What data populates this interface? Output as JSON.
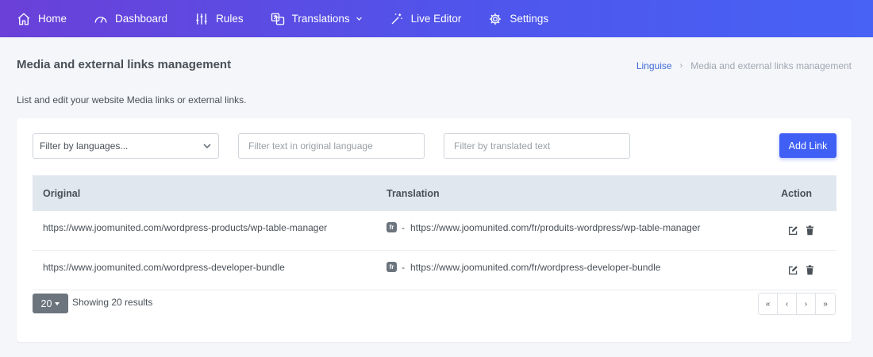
{
  "nav": {
    "items": [
      {
        "label": "Home",
        "icon": "home-icon"
      },
      {
        "label": "Dashboard",
        "icon": "gauge-icon"
      },
      {
        "label": "Rules",
        "icon": "sliders-icon"
      },
      {
        "label": "Translations",
        "icon": "translate-icon"
      },
      {
        "label": "Live Editor",
        "icon": "magic-wand-icon"
      },
      {
        "label": "Settings",
        "icon": "gear-icon"
      }
    ]
  },
  "page": {
    "title": "Media and external links management",
    "subtitle": "List and edit your website Media links or external links."
  },
  "breadcrumb": {
    "root": "Linguise",
    "separator": "›",
    "current": "Media and external links management"
  },
  "filters": {
    "language_placeholder": "Filter by languages...",
    "original_placeholder": "Filter text in original language",
    "translated_placeholder": "Filter by translated text"
  },
  "buttons": {
    "add_link": "Add Link"
  },
  "table": {
    "headers": {
      "original": "Original",
      "translation": "Translation",
      "action": "Action"
    },
    "rows": [
      {
        "original": "https://www.joomunited.com/wordpress-products/wp-table-manager",
        "lang": "fr",
        "translation": "https://www.joomunited.com/fr/produits-wordpress/wp-table-manager"
      },
      {
        "original": "https://www.joomunited.com/wordpress-developer-bundle",
        "lang": "fr",
        "translation": "https://www.joomunited.com/fr/wordpress-developer-bundle"
      }
    ],
    "dash": "-"
  },
  "footer": {
    "per_page": "20",
    "showing": "Showing 20 results",
    "pager": [
      "«",
      "‹",
      "›",
      "»"
    ]
  },
  "colors": {
    "nav_gradient_start": "#6a40d8",
    "nav_gradient_end": "#4762f5",
    "primary": "#3f5ff5",
    "link": "#3f6ad8",
    "table_header_bg": "#e1e7ef",
    "badge": "#6c757d"
  }
}
